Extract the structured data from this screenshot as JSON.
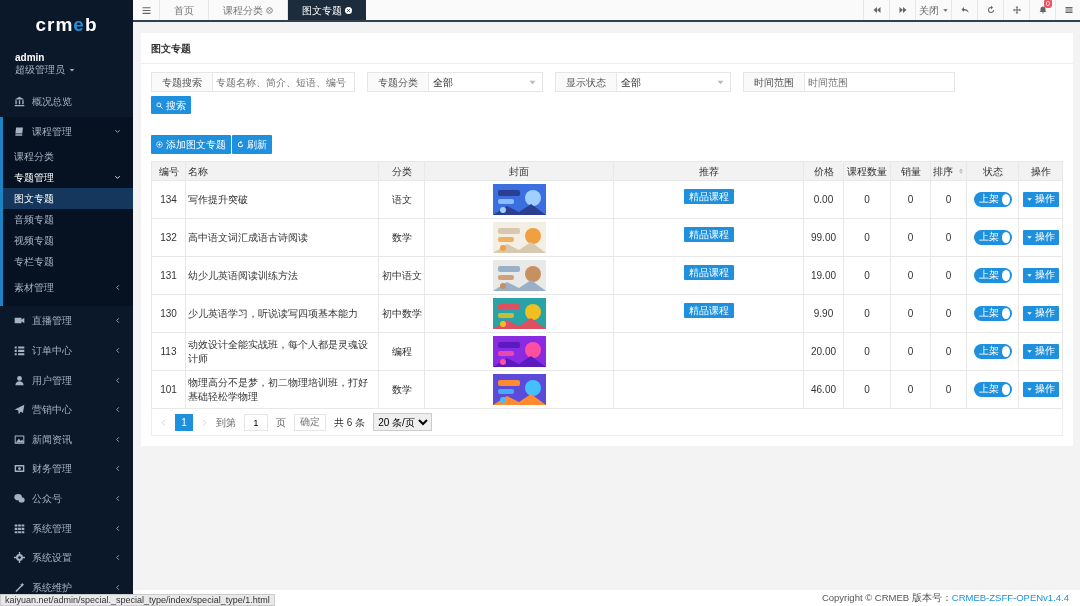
{
  "sidebar": {
    "logo": "crmeb",
    "user": {
      "name": "admin",
      "role": "超级管理员"
    },
    "items": [
      {
        "label": "概况总览",
        "kind": "link",
        "selected": false
      },
      {
        "label": "课程管理",
        "kind": "group",
        "expanded": true,
        "children": [
          {
            "label": "课程分类",
            "kind": "link",
            "selected": false
          },
          {
            "label": "专题管理",
            "kind": "group",
            "expanded": true,
            "children": [
              {
                "label": "图文专题",
                "kind": "link",
                "selected": true
              },
              {
                "label": "音频专题",
                "kind": "link",
                "selected": false
              },
              {
                "label": "视频专题",
                "kind": "link",
                "selected": false
              },
              {
                "label": "专栏专题",
                "kind": "link",
                "selected": false
              }
            ]
          },
          {
            "label": "素材管理",
            "kind": "group",
            "expanded": false
          }
        ]
      },
      {
        "label": "直播管理",
        "kind": "group",
        "expanded": false
      },
      {
        "label": "订单中心",
        "kind": "group",
        "expanded": false
      },
      {
        "label": "用户管理",
        "kind": "group",
        "expanded": false
      },
      {
        "label": "营销中心",
        "kind": "group",
        "expanded": false
      },
      {
        "label": "新闻资讯",
        "kind": "group",
        "expanded": false
      },
      {
        "label": "财务管理",
        "kind": "group",
        "expanded": false
      },
      {
        "label": "公众号",
        "kind": "group",
        "expanded": false
      },
      {
        "label": "系统管理",
        "kind": "group",
        "expanded": false
      },
      {
        "label": "系统设置",
        "kind": "group",
        "expanded": false
      },
      {
        "label": "系统维护",
        "kind": "group",
        "expanded": false
      }
    ]
  },
  "tabs": [
    {
      "label": "首页",
      "selected": false,
      "closable": false
    },
    {
      "label": "课程分类",
      "selected": false,
      "closable": true
    },
    {
      "label": "图文专题",
      "selected": true,
      "closable": true
    }
  ],
  "toolbar": {
    "close_menu": "关闭",
    "notifications": "0"
  },
  "card": {
    "title": "图文专题",
    "filters": [
      {
        "kind": "input",
        "label": "专题搜索",
        "placeholder": "专题名称、简介、短语、编号"
      },
      {
        "kind": "select",
        "label": "专题分类",
        "value": "全部"
      },
      {
        "kind": "select",
        "label": "显示状态",
        "value": "全部"
      },
      {
        "kind": "input",
        "label": "时间范围",
        "placeholder": "时间范围"
      }
    ],
    "search_button": "搜索",
    "add_button": "添加图文专题",
    "refresh_button": "刷新"
  },
  "table": {
    "columns": [
      {
        "label": "编号",
        "sortable": false
      },
      {
        "label": "名称",
        "sortable": false
      },
      {
        "label": "分类",
        "sortable": false
      },
      {
        "label": "封面",
        "sortable": false
      },
      {
        "label": "推荐",
        "sortable": false
      },
      {
        "label": "价格",
        "sortable": false
      },
      {
        "label": "课程数量",
        "sortable": false
      },
      {
        "label": "销量",
        "sortable": false
      },
      {
        "label": "排序",
        "sortable": true
      },
      {
        "label": "状态",
        "sortable": false
      },
      {
        "label": "操作",
        "sortable": false
      }
    ],
    "rows": [
      {
        "id": "134",
        "name": "写作提升突破",
        "category": "语文",
        "recommend": "精品课程",
        "price": "0.00",
        "courses": "0",
        "sales": "0",
        "sort": "0",
        "status": "上架",
        "on": true,
        "action": "操作"
      },
      {
        "id": "132",
        "name": "高中语文词汇成语古诗阅读",
        "category": "数学",
        "recommend": "精品课程",
        "price": "99.00",
        "courses": "0",
        "sales": "0",
        "sort": "0",
        "status": "上架",
        "on": true,
        "action": "操作"
      },
      {
        "id": "131",
        "name": "幼少儿英语阅读训练方法",
        "category": "初中语文",
        "recommend": "精品课程",
        "price": "19.00",
        "courses": "0",
        "sales": "0",
        "sort": "0",
        "status": "上架",
        "on": true,
        "action": "操作"
      },
      {
        "id": "130",
        "name": "少儿英语学习，听说读写四项基本能力",
        "category": "初中数学",
        "recommend": "精品课程",
        "price": "9.90",
        "courses": "0",
        "sales": "0",
        "sort": "0",
        "status": "上架",
        "on": true,
        "action": "操作"
      },
      {
        "id": "113",
        "name": "动效设计全能实战班，每个人都是灵魂设计师",
        "category": "编程",
        "price": "20.00",
        "courses": "0",
        "sales": "0",
        "sort": "0",
        "status": "上架",
        "on": true,
        "action": "操作"
      },
      {
        "id": "101",
        "name": "物理高分不是梦，初二物理培训班，打好基础轻松学物理",
        "category": "数学",
        "price": "46.00",
        "courses": "0",
        "sales": "0",
        "sort": "0",
        "status": "上架",
        "on": true,
        "action": "操作"
      }
    ]
  },
  "pagination": {
    "pages": [
      {
        "label": "1",
        "selected": true
      }
    ],
    "goto_label": "到第",
    "goto_value": "1",
    "page_unit": "页",
    "confirm": "确定",
    "total": "共 6 条",
    "page_size": "20 条/页"
  },
  "footer": {
    "copyright": "Copyright © CRMEB 版本号：",
    "version": "CRMEB-ZSFF-OPENv1.4.4"
  },
  "status_url": "kaiyuan.net/admin/special._special_type/index/special_type/1.html"
}
